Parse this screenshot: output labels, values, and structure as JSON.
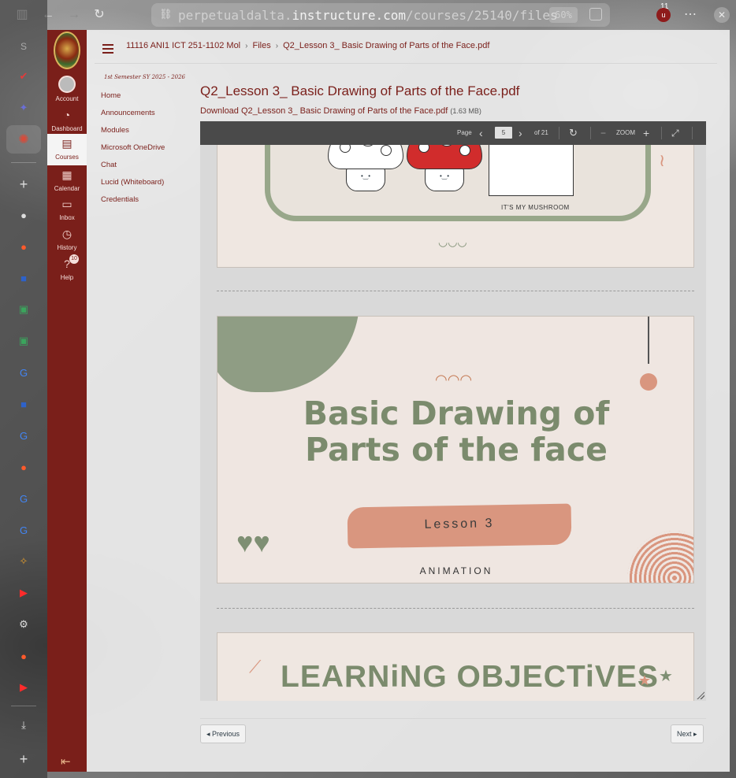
{
  "browser": {
    "url_prefix": "perpetualdalta.",
    "url_host": "instructure.com",
    "url_path": "/courses/25140/files",
    "zoom": "60%",
    "extension_count": "11",
    "extension_label": "u",
    "side_letter": "S"
  },
  "canvas": {
    "global_nav": {
      "account": "Account",
      "dashboard": "Dashboard",
      "courses": "Courses",
      "calendar": "Calendar",
      "inbox": "Inbox",
      "history": "History",
      "help": "Help",
      "help_badge": "10"
    },
    "breadcrumb": {
      "course": "11116 ANI1 ICT 251-1102 Mol",
      "files": "Files",
      "file": "Q2_Lesson 3_ Basic Drawing of Parts of the Face.pdf"
    },
    "course_nav": {
      "term": "1st Semester SY 2025 - 2026",
      "items": [
        "Home",
        "Announcements",
        "Modules",
        "Microsoft OneDrive",
        "Chat",
        "Lucid (Whiteboard)",
        "Credentials"
      ]
    },
    "file": {
      "title": "Q2_Lesson 3_ Basic Drawing of Parts of the Face.pdf",
      "download_label": "Download Q2_Lesson 3_ Basic Drawing of Parts of the Face.pdf",
      "size": "(1.63 MB)"
    },
    "viewer": {
      "page_label": "Page",
      "current_page": "5",
      "total_pages": "of 21",
      "zoom_label": "ZOOM"
    },
    "slides": {
      "caption": "IT'S MY MUSHROOM",
      "title_line1": "Basic Drawing of",
      "title_line2": "Parts of the face",
      "lesson": "Lesson 3",
      "subject": "ANIMATION",
      "objectives": "LEARNiNG OBJECTiVES"
    },
    "pager": {
      "previous": "◂ Previous",
      "next": "Next ▸"
    }
  }
}
